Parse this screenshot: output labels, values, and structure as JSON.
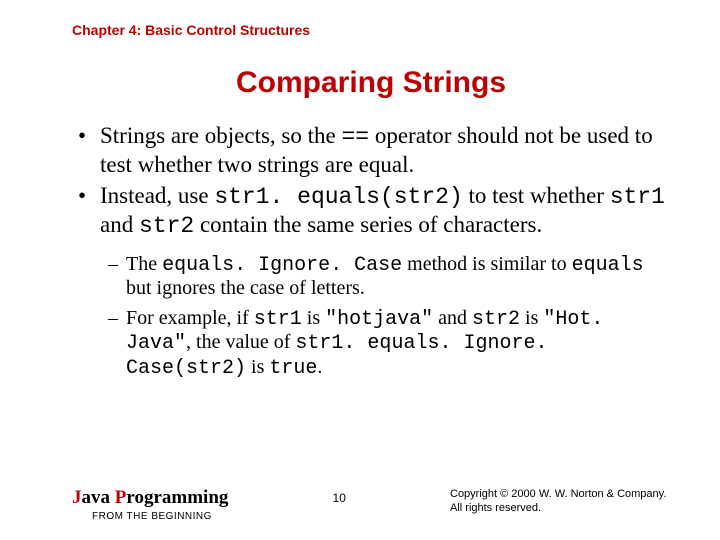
{
  "chapter": "Chapter 4: Basic Control Structures",
  "title": "Comparing Strings",
  "bullets": {
    "b1_pre": "Strings are objects, so the ",
    "b1_op": "==",
    "b1_post": " operator should not be used to test whether two strings are equal.",
    "b2_pre": "Instead, use ",
    "b2_code": "str1. equals(str2)",
    "b2_mid": " to test whether ",
    "b2_s1": "str1",
    "b2_and": " and ",
    "b2_s2": "str2",
    "b2_post": " contain the same series of characters."
  },
  "sub": {
    "s1_pre": "The ",
    "s1_m1": "equals. Ignore. Case",
    "s1_mid": " method is similar to ",
    "s1_m2": "equals",
    "s1_post": " but ignores the case of letters.",
    "s2_pre": "For example, if ",
    "s2_v1": "str1",
    "s2_is1": " is ",
    "s2_q1": "\"hotjava\"",
    "s2_and": " and ",
    "s2_v2": "str2",
    "s2_is2": " is ",
    "s2_q2": "\"Hot. Java\"",
    "s2_mid": ", the value of ",
    "s2_expr": "str1. equals. Ignore. Case(str2)",
    "s2_is3": " is ",
    "s2_true": "true",
    "s2_dot": "."
  },
  "footer": {
    "brand_java_j": "J",
    "brand_java_rest": "ava ",
    "brand_prog_p": "P",
    "brand_prog_rest": "rogramming",
    "brand_sub": "FROM THE BEGINNING",
    "page": "10",
    "copyright1": "Copyright © 2000 W. W. Norton & Company.",
    "copyright2": "All rights reserved."
  }
}
